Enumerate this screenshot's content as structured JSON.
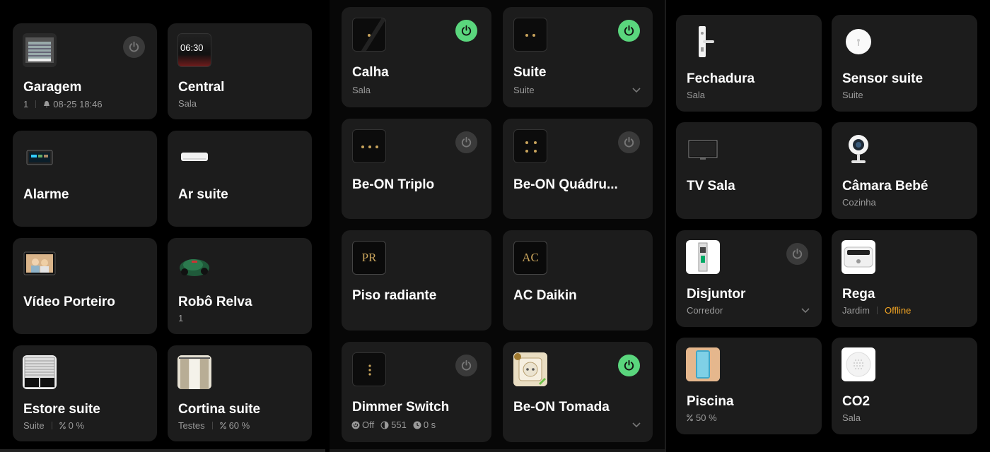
{
  "left": {
    "garagem": {
      "title": "Garagem",
      "count": "1",
      "time": "08-25 18:46"
    },
    "central": {
      "title": "Central",
      "room": "Sala",
      "screen_time": "06:30"
    },
    "alarme": {
      "title": "Alarme"
    },
    "ar_suite": {
      "title": "Ar suite"
    },
    "video_porteiro": {
      "title": "Vídeo Porteiro"
    },
    "robo_relva": {
      "title": "Robô Relva",
      "count": "1"
    },
    "estore_suite": {
      "title": "Estore suite",
      "room": "Suite",
      "level": "0 %"
    },
    "cortina_suite": {
      "title": "Cortina suite",
      "room": "Testes",
      "level": "60 %"
    }
  },
  "middle": {
    "calha": {
      "title": "Calha",
      "room": "Sala",
      "power": "on"
    },
    "suite": {
      "title": "Suite",
      "room": "Suite",
      "power": "on"
    },
    "triplo": {
      "title": "Be-ON Triplo",
      "power": "off"
    },
    "quadruplo": {
      "title": "Be-ON Quádru...",
      "power": "off"
    },
    "piso": {
      "title": "Piso radiante",
      "thumb_text": "PR"
    },
    "daikin": {
      "title": "AC Daikin",
      "thumb_text": "AC"
    },
    "dimmer": {
      "title": "Dimmer Switch",
      "state": "Off",
      "level": "551",
      "timer": "0 s",
      "power": "off"
    },
    "tomada": {
      "title": "Be-ON Tomada",
      "power": "on"
    }
  },
  "right": {
    "fechadura": {
      "title": "Fechadura",
      "room": "Sala"
    },
    "sensor": {
      "title": "Sensor suite",
      "room": "Suite"
    },
    "tv": {
      "title": "TV Sala"
    },
    "camara": {
      "title": "Câmara Bebé",
      "room": "Cozinha"
    },
    "disjuntor": {
      "title": "Disjuntor",
      "room": "Corredor",
      "power": "off"
    },
    "rega": {
      "title": "Rega",
      "room": "Jardim",
      "status": "Offline"
    },
    "piscina": {
      "title": "Piscina",
      "level": "50 %"
    },
    "co2": {
      "title": "CO2",
      "room": "Sala"
    }
  },
  "colors": {
    "card": "#1c1c1c",
    "power_on": "#5ad67d",
    "power_off": "#3a3a3a",
    "offline": "#f5a623",
    "subtext": "#9a9a9a"
  },
  "icons": {
    "power": "power-icon",
    "chevron": "chevron-down-icon",
    "bell": "bell-icon",
    "percent": "percent-icon"
  }
}
